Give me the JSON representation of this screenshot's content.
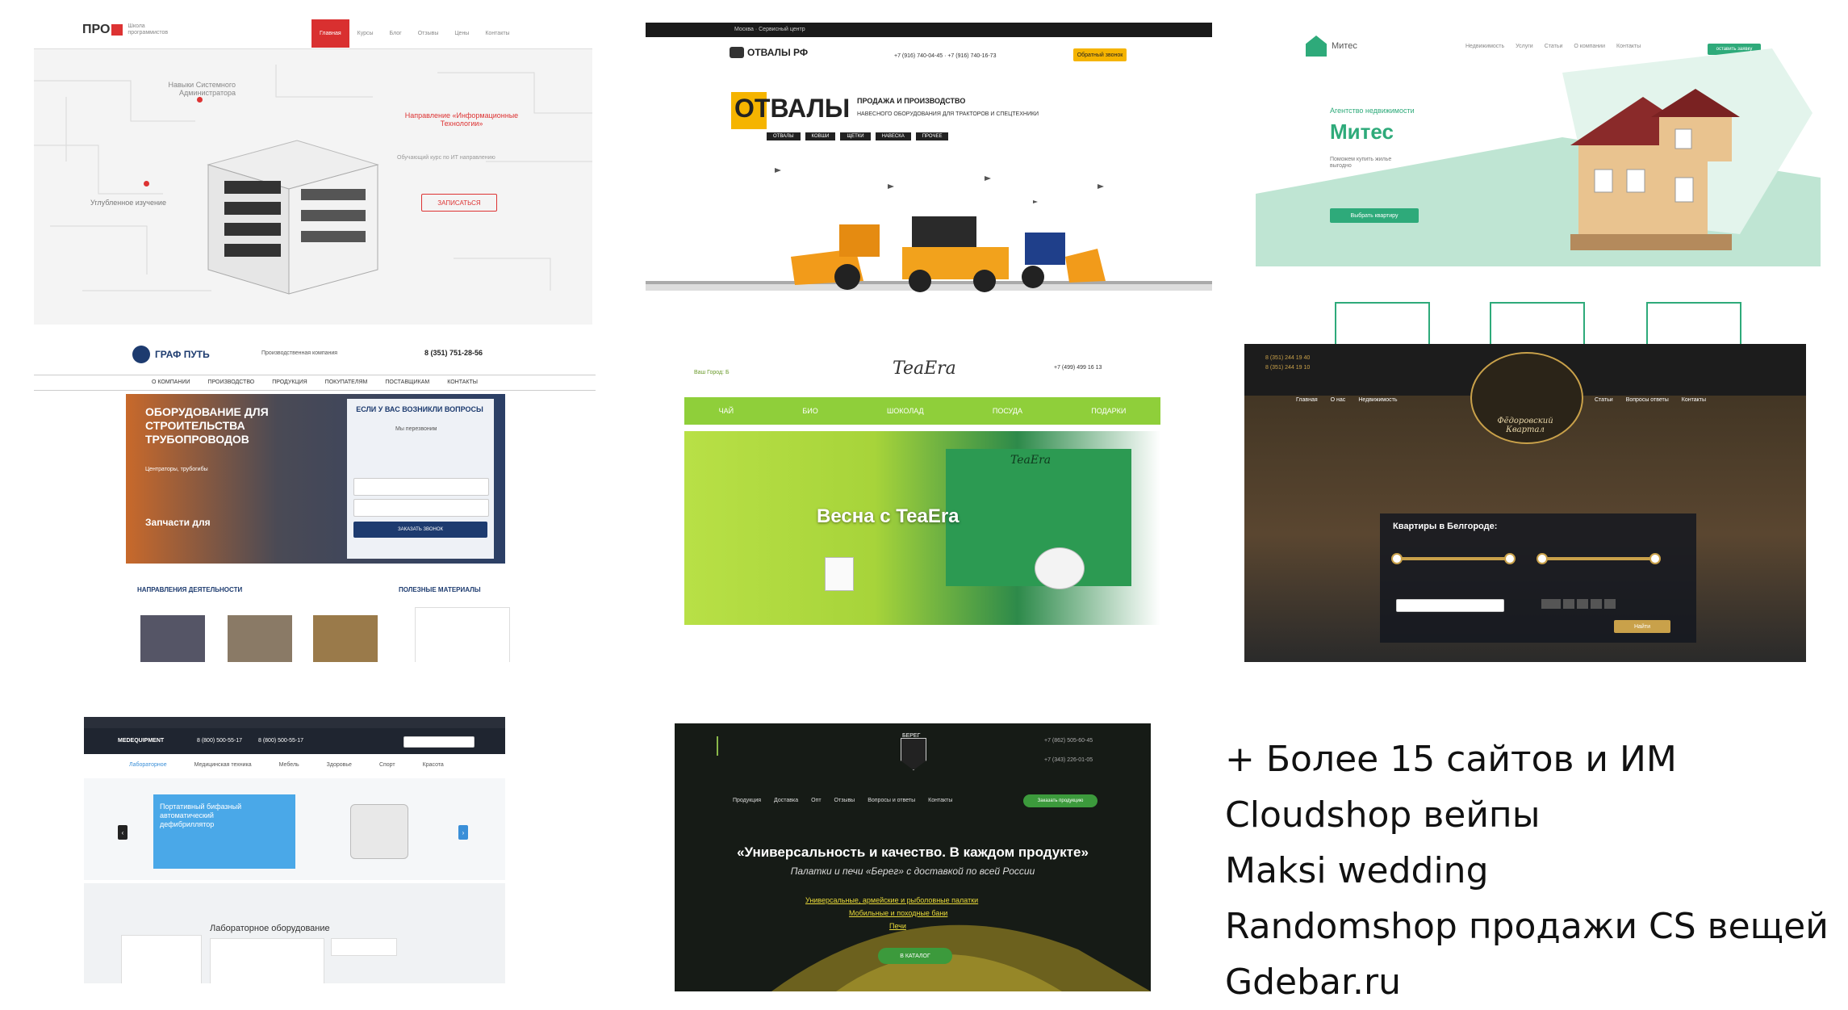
{
  "thumb1": {
    "logo": "ПРО",
    "logo_sub": "Школа программистов",
    "nav": [
      "Главная",
      "Курсы",
      "Блог",
      "Отзывы",
      "Цены",
      "Контакты"
    ],
    "label_a": "Навыки Системного Администратора",
    "label_b": "Направление «Информационные Технологии»",
    "label_c": "Углубленное изучение",
    "description": "Обучающий курс по ИТ направлению",
    "cta": "ЗАПИСАТЬСЯ"
  },
  "thumb2": {
    "topbar": "Москва · Сервисный центр",
    "logo": "ОТВАЛЫ РФ",
    "phone": "+7 (916) 740-04-45 · +7 (916) 740-16-73",
    "callback": "Обратный звонок",
    "hero_big": "ОТВАЛЫ",
    "hero_line1": "ПРОДАЖА И ПРОИЗВОДСТВО",
    "hero_line2": "НАВЕСНОГО ОБОРУДОВАНИЯ ДЛЯ ТРАКТОРОВ И СПЕЦТЕХНИКИ",
    "tags": [
      "ОТВАЛЫ",
      "КОВШИ",
      "ЩЕТКИ",
      "НАВЕСКА",
      "ПРОЧЕЕ"
    ]
  },
  "thumb3": {
    "logo": "Митес",
    "nav": [
      "Недвижимость",
      "Услуги",
      "Статьи",
      "О компании",
      "Контакты"
    ],
    "nav_button": "оставить заявку",
    "kicker": "Агентство недвижимости",
    "title": "Митес",
    "text": "Поможем купить жилье выгодно",
    "cta": "Выбрать квартиру"
  },
  "thumb4": {
    "logo": "ГРАФ ПУТЬ",
    "logo_sub": "Производственная компания",
    "phone": "8 (351) 751-28-56",
    "nav": [
      "О КОМПАНИИ",
      "ПРОИЗВОДСТВО",
      "ПРОДУКЦИЯ",
      "ПОКУПАТЕЛЯМ",
      "ПОСТАВЩИКАМ",
      "КОНТАКТЫ"
    ],
    "hero_title": "ОБОРУДОВАНИЕ ДЛЯ СТРОИТЕЛЬСТВА ТРУБОПРОВОДОВ",
    "hero_sub": "Центраторы, трубогибы",
    "hero_title2": "Запчасти для",
    "form_title": "ЕСЛИ У ВАС ВОЗНИКЛИ ВОПРОСЫ",
    "form_sub": "Мы перезвоним",
    "form_button": "ЗАКАЗАТЬ ЗВОНОК",
    "section_left": "НАПРАВЛЕНИЯ ДЕЯТЕЛЬНОСТИ",
    "section_right": "ПОЛЕЗНЫЕ МАТЕРИАЛЫ"
  },
  "thumb5": {
    "logo": "TeaEra",
    "phone": "+7 (499) 499 16 13",
    "left_link": "Ваш Город: Б",
    "nav": [
      "ЧАЙ",
      "БИО",
      "ШОКОЛАД",
      "ПОСУДА",
      "ПОДАРКИ"
    ],
    "banner": "Весна с TeaEra",
    "box_logo": "TeaEra"
  },
  "thumb6": {
    "phone1": "8 (351) 244 19 40",
    "phone2": "8 (351) 244 19 10",
    "nav_left": [
      "Главная",
      "О нас",
      "Недвижимость"
    ],
    "nav_right": [
      "Статьи",
      "Вопросы ответы",
      "Контакты"
    ],
    "emblem": "Фёдоровский Квартал",
    "search_title": "Квартиры в Белгороде:",
    "search_button": "Найти"
  },
  "thumb7": {
    "logo": "MEDEQUIPMENT",
    "phone1": "8 (800) 500-55-17",
    "phone2": "8 (800) 500-55-17",
    "tabs": [
      "Лабораторное",
      "Медицинская техника",
      "Мебель",
      "Здоровье",
      "Спорт",
      "Красота"
    ],
    "banner": "Портативный бифазный автоматический дефибриллятор",
    "page_title": "Лабораторное оборудование"
  },
  "thumb8": {
    "logo": "БЕРЕГ",
    "phone1": "+7 (862) 505-60-45",
    "phone2": "+7 (343) 226-01-05",
    "nav": [
      "Продукция",
      "Доставка",
      "Опт",
      "Отзывы",
      "Вопросы и ответы",
      "Контакты"
    ],
    "nav_button": "Заказать продукцию",
    "headline": "«Универсальность и качество. В каждом продукте»",
    "sub": "Палатки и печи «Берег» с доставкой по всей России",
    "link1": "Универсальные, армейские и рыболовные палатки",
    "link2": "Мобильные и походные бани",
    "link3": "Печи",
    "cta": "В КАТАЛОГ"
  },
  "side_list": [
    "+ Более 15 сайтов и ИМ",
    "Cloudshop вейпы",
    "Maksi wedding",
    "Randomshop продажи CS вещей",
    "Gdebar.ru"
  ]
}
